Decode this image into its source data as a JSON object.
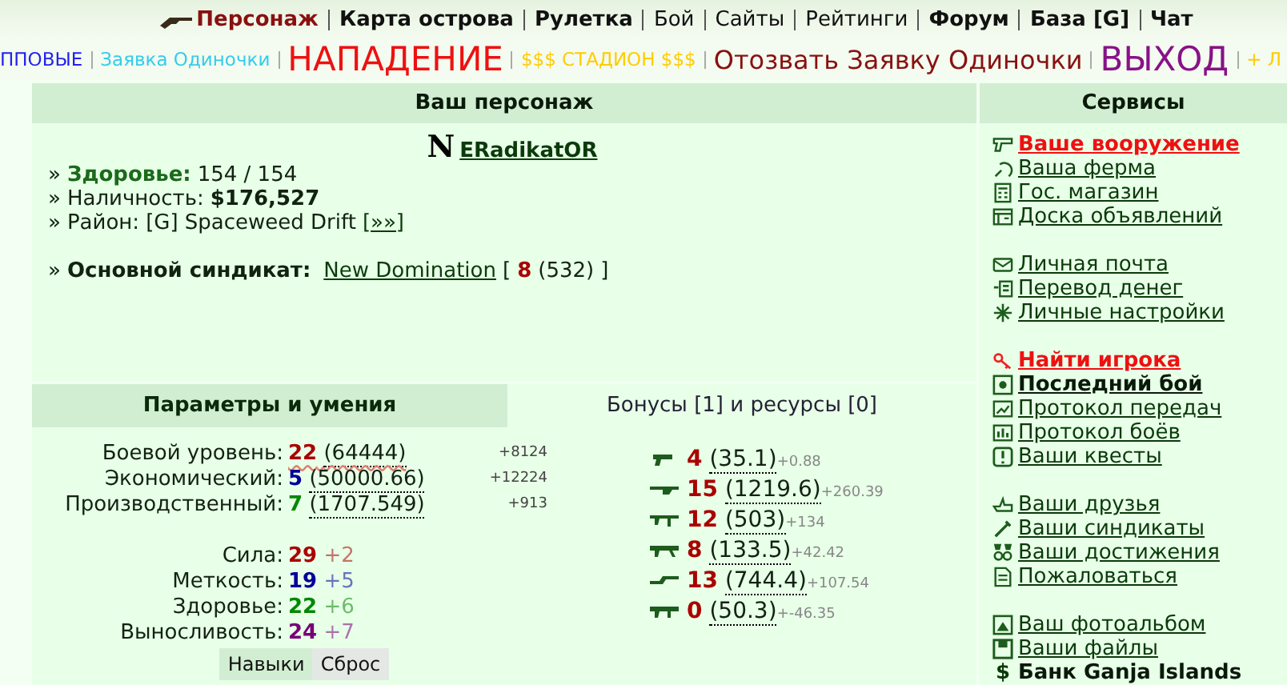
{
  "top_nav": [
    {
      "label": "Персонаж",
      "bold": true,
      "selected": true
    },
    {
      "label": "Карта острова",
      "bold": true,
      "selected": false
    },
    {
      "label": "Рулетка",
      "bold": true,
      "selected": false
    },
    {
      "label": "Бой",
      "bold": false,
      "selected": false
    },
    {
      "label": "Сайты",
      "bold": false,
      "selected": false
    },
    {
      "label": "Рейтинги",
      "bold": false,
      "selected": false
    },
    {
      "label": "Форум",
      "bold": true,
      "selected": false
    },
    {
      "label": "База [G]",
      "bold": true,
      "selected": false
    },
    {
      "label": "Чат",
      "bold": true,
      "selected": false
    }
  ],
  "action_bar": [
    {
      "label": "ППОВЫЕ",
      "kind": "small",
      "color": "#2222ee"
    },
    {
      "label": "Заявка Одиночки",
      "kind": "small",
      "color": "#33ccee"
    },
    {
      "label": "НАПАДЕНИЕ",
      "kind": "large",
      "color": "#ee1111"
    },
    {
      "label": "$$$ СТАДИОН $$$",
      "kind": "small",
      "color": "#ffcc00"
    },
    {
      "label": "Отозвать Заявку Одиночки",
      "kind": "medium",
      "color": "#881111"
    },
    {
      "label": "ВЫХОД",
      "kind": "large",
      "color": "#881188"
    },
    {
      "label": "+ Л",
      "kind": "small",
      "color": "#ffcc00"
    }
  ],
  "character": {
    "title": "Ваш персонаж",
    "faction_mark": "N",
    "name": "ERadikatOR",
    "lines": [
      {
        "kind": "health",
        "bullet": "»",
        "label": "Здоровье:",
        "value": "154 / 154"
      },
      {
        "kind": "money",
        "bullet": "»",
        "label": "Наличность:",
        "value": "$176,527"
      },
      {
        "kind": "district",
        "bullet": "»",
        "label": "Район:",
        "value": "[G] Spaceweed Drift",
        "link": "[»»]"
      }
    ],
    "syndicate": {
      "bullet": "»",
      "label": "Основной синдикат:",
      "name": "New Domination",
      "open": "[",
      "level": "8",
      "points": "(532)",
      "close": "]"
    }
  },
  "tabs": [
    {
      "label": "Параметры и умения",
      "selected": true
    },
    {
      "label": "Бонусы [1] и ресурсы [0]",
      "selected": false
    }
  ],
  "levels": [
    {
      "label": "Боевой уровень:",
      "value": "22",
      "exp": "(64444)",
      "bonus": "+8124",
      "color": "#aa0000",
      "flagged": true
    },
    {
      "label": "Экономический:",
      "value": "5",
      "exp": "(50000.66)",
      "bonus": "+12224",
      "color": "#000099",
      "flagged": false
    },
    {
      "label": "Производственный:",
      "value": "7",
      "exp": "(1707.549)",
      "bonus": "+913",
      "color": "#008800",
      "flagged": false
    }
  ],
  "attributes": [
    {
      "label": "Сила:",
      "value": "29",
      "plus": "+2",
      "color": "#aa0000"
    },
    {
      "label": "Меткость:",
      "value": "19",
      "plus": "+5",
      "color": "#000099"
    },
    {
      "label": "Здоровье:",
      "value": "22",
      "plus": "+6",
      "color": "#008800"
    },
    {
      "label": "Выносливость:",
      "value": "24",
      "plus": "+7",
      "color": "#770077"
    }
  ],
  "buttons": [
    {
      "label": "Навыки",
      "selected": true
    },
    {
      "label": "Сброс",
      "selected": false
    }
  ],
  "weapons": [
    {
      "level": "4",
      "exp": "(35.1)",
      "bonus": "+0.88"
    },
    {
      "level": "15",
      "exp": "(1219.6)",
      "bonus": "+260.39"
    },
    {
      "level": "12",
      "exp": "(503)",
      "bonus": "+134"
    },
    {
      "level": "8",
      "exp": "(133.5)",
      "bonus": "+42.42"
    },
    {
      "level": "13",
      "exp": "(744.4)",
      "bonus": "+107.54"
    },
    {
      "level": "0",
      "exp": "(50.3)",
      "bonus": "+-46.35"
    }
  ],
  "services": {
    "title": "Сервисы",
    "groups": [
      [
        {
          "label": "Ваше вооружение",
          "kind": "alert"
        },
        {
          "label": "Ваша ферма",
          "kind": "link"
        },
        {
          "label": "Гос. магазин",
          "kind": "link"
        },
        {
          "label": "Доска объявлений",
          "kind": "link"
        }
      ],
      [
        {
          "label": "Личная почта",
          "kind": "link"
        },
        {
          "label": "Перевод денег",
          "kind": "link"
        },
        {
          "label": "Личные настройки",
          "kind": "link"
        }
      ],
      [
        {
          "label": "Найти игрока",
          "kind": "alert"
        },
        {
          "label": "Последний бой",
          "kind": "bold"
        },
        {
          "label": "Протокол передач",
          "kind": "link"
        },
        {
          "label": "Протокол боёв",
          "kind": "link"
        },
        {
          "label": "Ваши квесты",
          "kind": "link"
        }
      ],
      [
        {
          "label": "Ваши друзья",
          "kind": "link"
        },
        {
          "label": "Ваши синдикаты",
          "kind": "link"
        },
        {
          "label": "Ваши достижения",
          "kind": "link"
        },
        {
          "label": "Пожаловаться",
          "kind": "link"
        }
      ],
      [
        {
          "label": "Ваш фотоальбом",
          "kind": "link"
        },
        {
          "label": "Ваши файлы",
          "kind": "link"
        },
        {
          "label": "Банк Ganja Islands",
          "kind": "plain",
          "glyph": "$"
        }
      ]
    ]
  }
}
